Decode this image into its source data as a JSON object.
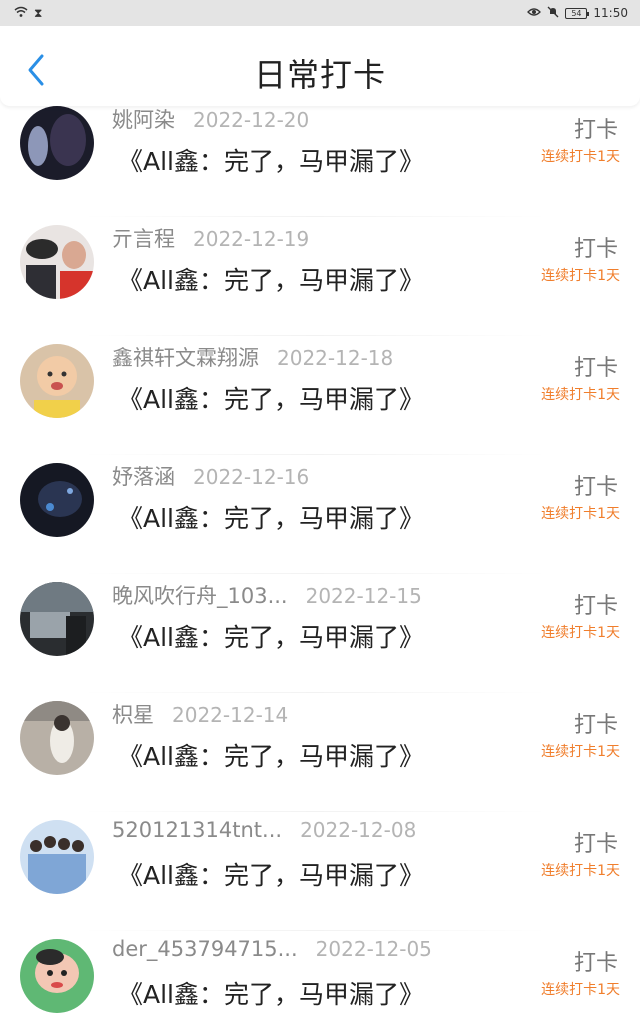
{
  "status_bar": {
    "time": "11:50",
    "battery": "54"
  },
  "header": {
    "title": "日常打卡"
  },
  "checkin_label": "打卡",
  "entries": [
    {
      "name": "姚阿染",
      "date": "2022-12-20",
      "book": "《All鑫：完了，马甲漏了》",
      "streak": "连续打卡1天"
    },
    {
      "name": "亓言程",
      "date": "2022-12-19",
      "book": "《All鑫：完了，马甲漏了》",
      "streak": "连续打卡1天"
    },
    {
      "name": "鑫祺轩文霖翔源",
      "date": "2022-12-18",
      "book": "《All鑫：完了，马甲漏了》",
      "streak": "连续打卡1天"
    },
    {
      "name": "妤落涵",
      "date": "2022-12-16",
      "book": "《All鑫：完了，马甲漏了》",
      "streak": "连续打卡1天"
    },
    {
      "name": "晚风吹行舟_103...",
      "date": "2022-12-15",
      "book": "《All鑫：完了，马甲漏了》",
      "streak": "连续打卡1天"
    },
    {
      "name": "枳星",
      "date": "2022-12-14",
      "book": "《All鑫：完了，马甲漏了》",
      "streak": "连续打卡1天"
    },
    {
      "name": "520121314tnt...",
      "date": "2022-12-08",
      "book": "《All鑫：完了，马甲漏了》",
      "streak": "连续打卡1天"
    },
    {
      "name": "der_453794715...",
      "date": "2022-12-05",
      "book": "《All鑫：完了，马甲漏了》",
      "streak": "连续打卡1天"
    }
  ]
}
